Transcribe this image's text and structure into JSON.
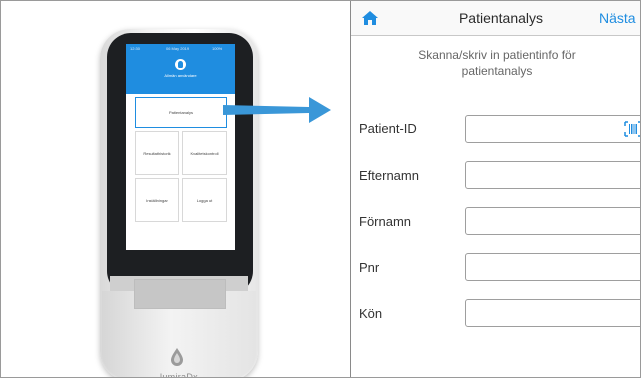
{
  "device": {
    "status_time": "12:30",
    "status_date": "06 May 2019",
    "status_battery": "100%",
    "user_label": "Allmän användare",
    "tiles": [
      {
        "label": "Patientanalys"
      },
      {
        "label": "Resultathistorik"
      },
      {
        "label": "Kvalitetskontroll"
      },
      {
        "label": "Inställningar"
      },
      {
        "label": "Logga ut"
      }
    ],
    "brand": "lumiraDx"
  },
  "panel": {
    "title": "Patientanalys",
    "next_label": "Nästa",
    "instruction": "Skanna/skriv in patientinfo för patientanalys",
    "fields": [
      {
        "label": "Patient-ID",
        "value": ""
      },
      {
        "label": "Efternamn",
        "value": ""
      },
      {
        "label": "Förnamn",
        "value": ""
      },
      {
        "label": "Pnr",
        "value": ""
      },
      {
        "label": "Kön",
        "value": ""
      }
    ]
  },
  "colors": {
    "accent": "#1f8de0",
    "arrow": "#3a97d8"
  }
}
